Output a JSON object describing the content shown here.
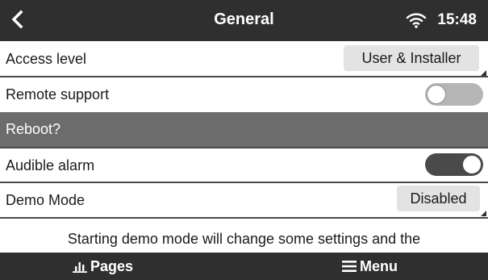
{
  "header": {
    "title": "General",
    "time": "15:48",
    "back_icon": "chevron-left-icon",
    "wifi_icon": "wifi-icon"
  },
  "rows": {
    "access_level": {
      "label": "Access level",
      "value": "User & Installer"
    },
    "remote_support": {
      "label": "Remote support",
      "enabled": false
    },
    "reboot": {
      "label": "Reboot?"
    },
    "audible_alarm": {
      "label": "Audible alarm",
      "enabled": true
    },
    "demo_mode": {
      "label": "Demo Mode",
      "value": "Disabled"
    }
  },
  "info_text": "Starting demo mode will change some settings and the",
  "footer": {
    "pages_label": "Pages",
    "menu_label": "Menu",
    "pages_icon": "bar-chart-icon",
    "menu_icon": "hamburger-menu-icon"
  },
  "colors": {
    "header_bg": "#2f2f2f",
    "reboot_bg": "#6c6c6c",
    "pill_bg": "#e3e3e3",
    "toggle_on": "#4a4a4a",
    "toggle_off": "#b5b5b5"
  }
}
